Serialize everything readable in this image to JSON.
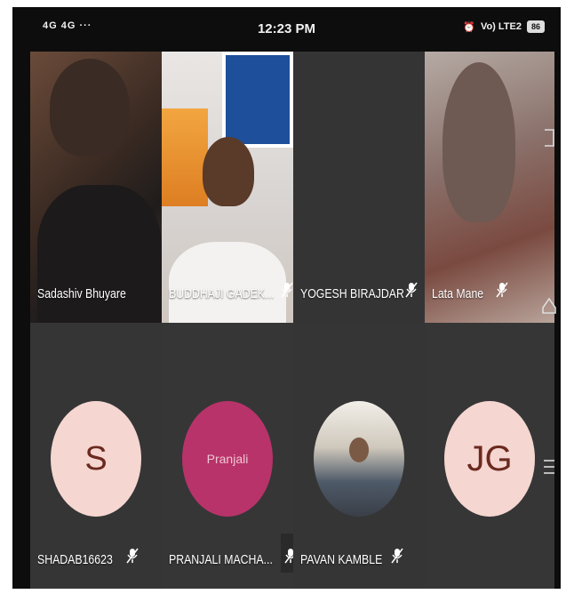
{
  "status_bar": {
    "left_indicators": "4G 4G ···",
    "time": "12:23 PM",
    "right_indicators": "Vo) LTE2",
    "battery": "86"
  },
  "participants": [
    {
      "name": "Sadashiv Bhuyare",
      "muted": false,
      "display": "video"
    },
    {
      "name": "BUDDHAJI GADEK...",
      "muted": true,
      "display": "video"
    },
    {
      "name": "YOGESH BIRAJDAR",
      "muted": true,
      "display": "video"
    },
    {
      "name": "Lata Mane",
      "muted": true,
      "display": "video"
    },
    {
      "name": "SHADAB16623",
      "muted": true,
      "display": "avatar",
      "avatar_text": "S"
    },
    {
      "name": "PRANJALI MACHA...",
      "muted": true,
      "display": "avatar",
      "avatar_text": "Pranjali"
    },
    {
      "name": "PAVAN KAMBLE",
      "muted": true,
      "display": "avatar-photo"
    },
    {
      "name": "",
      "muted": false,
      "display": "avatar",
      "avatar_text": "JG"
    }
  ],
  "nav_buttons": [
    "back-icon",
    "home-icon",
    "recents-icon"
  ],
  "colors": {
    "avatar_peach": "#f5d6d1",
    "avatar_pink": "#b8336a",
    "tile_bg": "#353535"
  }
}
